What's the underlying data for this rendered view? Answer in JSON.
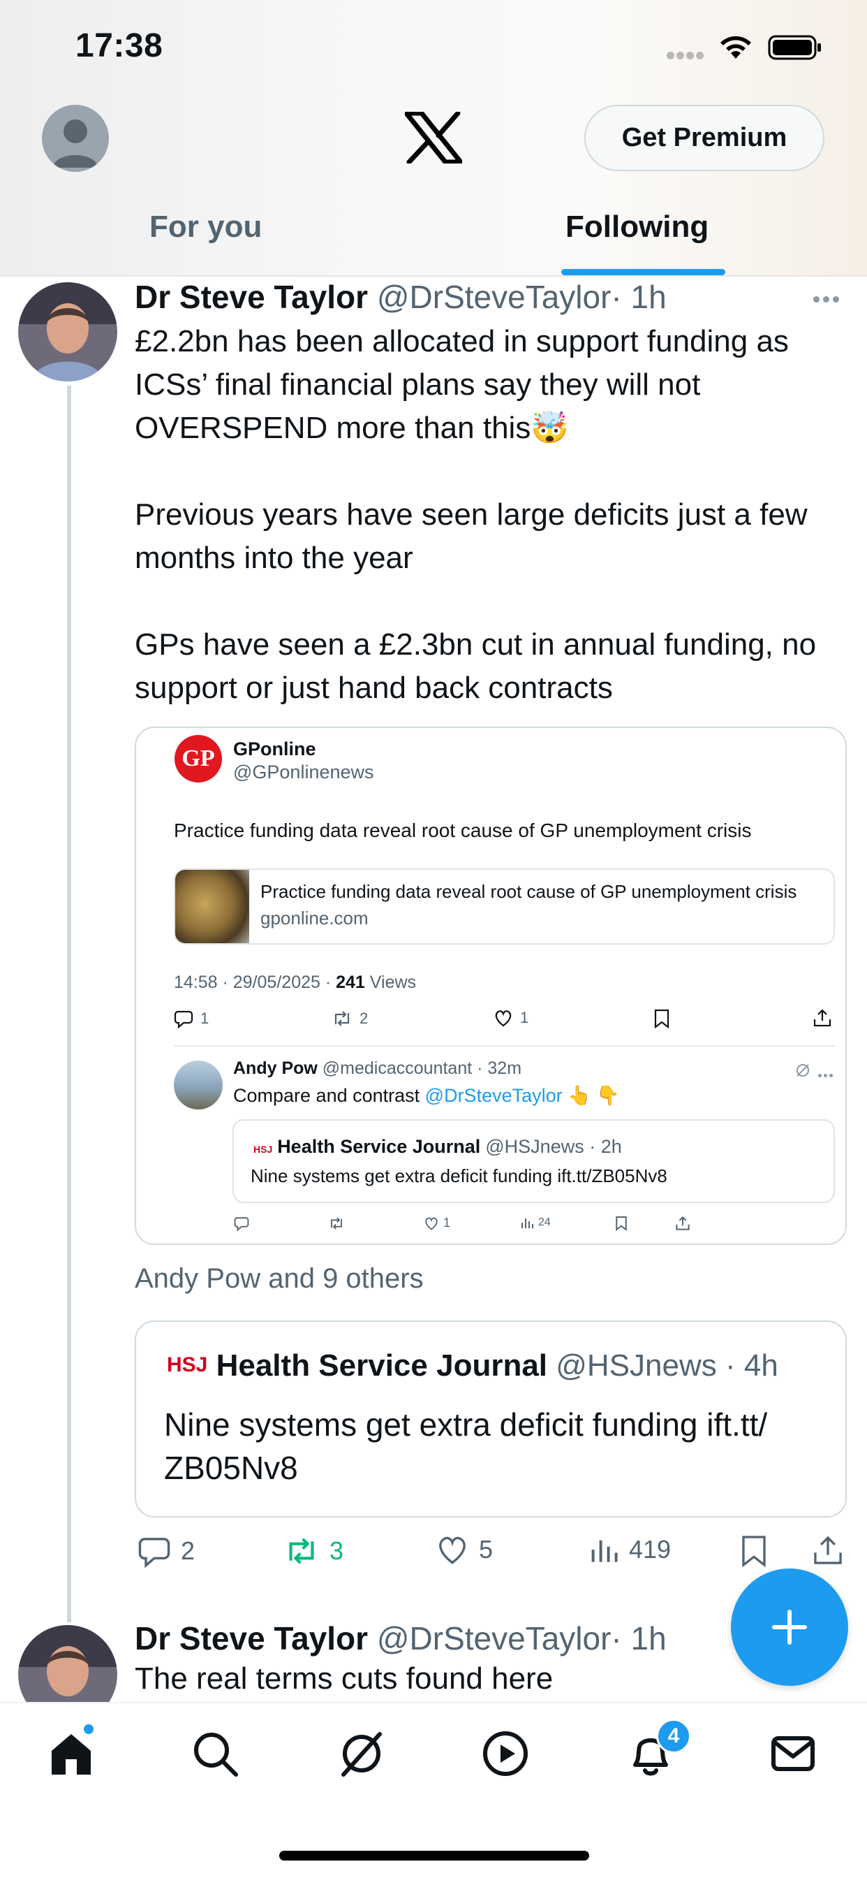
{
  "status_bar": {
    "time": "17:38"
  },
  "header": {
    "premium_label": "Get Premium",
    "tabs": [
      {
        "label": "For you",
        "active": false
      },
      {
        "label": "Following",
        "active": true
      }
    ],
    "accent_color": "#1d9bf0"
  },
  "tweet1": {
    "author_name": "Dr Steve Taylor",
    "author_handle": "@DrSteveTaylor",
    "time": "· 1h",
    "text": "£2.2bn has been allocated in support funding as ICSs’ final financial plans say they will not OVERSPEND more than this🤯\n\nPrevious years have seen large deficits just a few months into the year\n\nGPs have seen a £2.3bn cut in annual funding, no support or just hand back contracts",
    "quote": {
      "logo_text": "GP",
      "name": "GPonline",
      "handle": "@GPonlinenews",
      "text": "Practice funding data reveal root cause of GP unemployment crisis",
      "link_title": "Practice funding data reveal root cause of GP unemployment crisis",
      "link_domain": "gponline.com",
      "timestamp": "14:58 · 29/05/2025 ·",
      "views_count": "241",
      "views_label": "Views",
      "replies": "1",
      "reposts": "2",
      "likes": "1",
      "reply": {
        "name": "Andy Pow",
        "handle": "@medicaccountant · 32m",
        "text_prefix": "Compare and contrast",
        "mention": "@DrSteveTaylor",
        "emoji": "👆 👇",
        "inner_logo": "HSJ",
        "inner_name": "Health Service Journal",
        "inner_handle": "@HSJnews · 2h",
        "inner_text": "Nine systems get extra deficit funding ift.tt/ZB05Nv8",
        "likes": "1",
        "views": "24"
      }
    },
    "liked_by": "Andy Pow and 9 others",
    "quote2": {
      "logo_text": "HSJ",
      "name": "Health Service Journal",
      "handle": "@HSJnews · 4h",
      "text": "Nine systems get extra deficit funding ift.tt/ ZB05Nv8"
    },
    "stats": {
      "replies": "2",
      "reposts": "3",
      "likes": "5",
      "views": "419",
      "repost_color": "#00ba7c"
    }
  },
  "tweet2": {
    "author_name": "Dr Steve Taylor",
    "author_handle": "@DrSteveTaylor",
    "time": "· 1h",
    "text": "The real terms cuts found here"
  },
  "bottom_nav": {
    "items": [
      "home-icon",
      "search-icon",
      "grok-icon",
      "video-icon",
      "notifications-icon",
      "messages-icon"
    ],
    "notifications_badge": "4"
  }
}
